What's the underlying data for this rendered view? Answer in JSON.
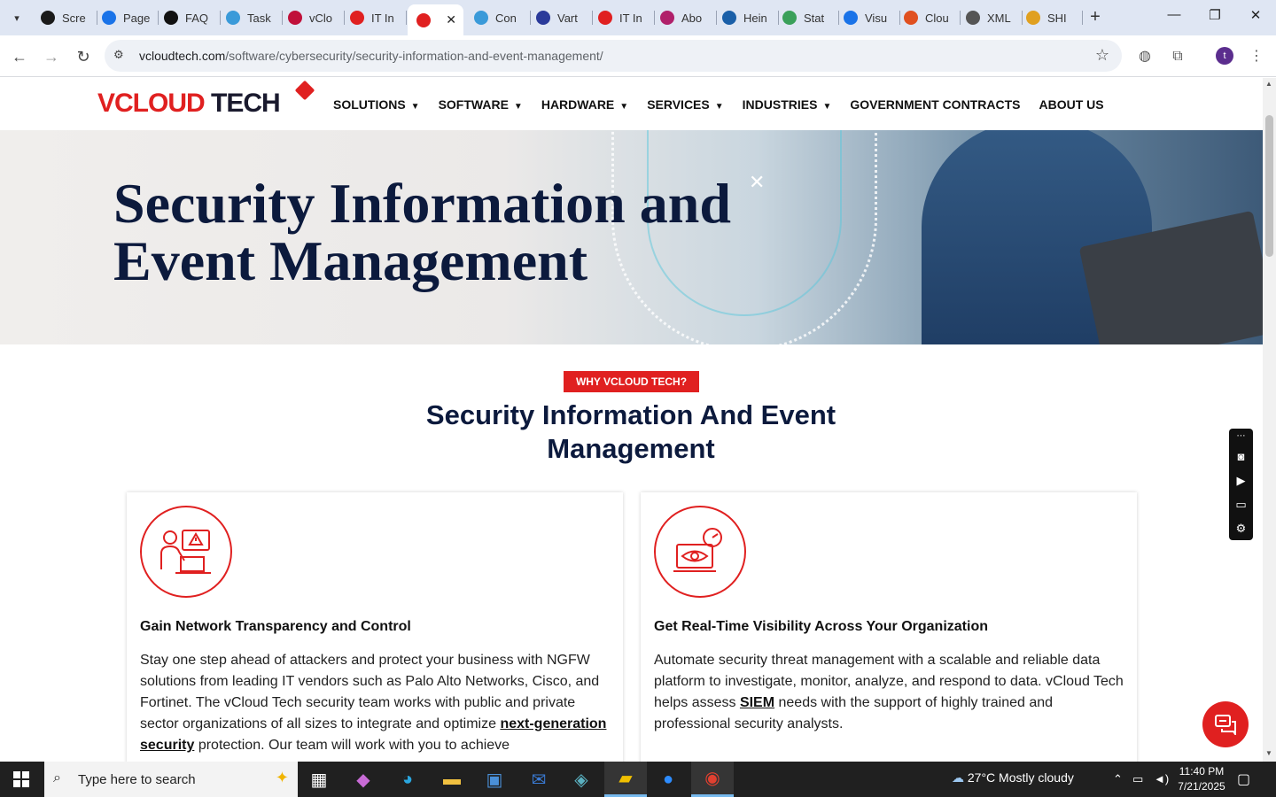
{
  "browser": {
    "tabs": [
      {
        "label": "Scre",
        "fav_color": "#1a1a1a"
      },
      {
        "label": "Page",
        "fav_color": "#1a73e8"
      },
      {
        "label": "FAQ",
        "fav_color": "#111111"
      },
      {
        "label": "Task",
        "fav_color": "#3a9ad9"
      },
      {
        "label": "vClo",
        "fav_color": "#c0103a"
      },
      {
        "label": "IT In",
        "fav_color": "#e02020"
      },
      {
        "label": "",
        "fav_color": "#e02020"
      },
      {
        "label": "Con",
        "fav_color": "#3a9ad9"
      },
      {
        "label": "Vart",
        "fav_color": "#2a3a9a"
      },
      {
        "label": "IT In",
        "fav_color": "#e02020"
      },
      {
        "label": "Abo",
        "fav_color": "#b0206a"
      },
      {
        "label": "Hein",
        "fav_color": "#1a5fa8"
      },
      {
        "label": "Stat",
        "fav_color": "#3aa05a"
      },
      {
        "label": "Visu",
        "fav_color": "#1a73e8"
      },
      {
        "label": "Clou",
        "fav_color": "#e05020"
      },
      {
        "label": "XML",
        "fav_color": "#555555"
      },
      {
        "label": "SHI",
        "fav_color": "#e0a020"
      }
    ],
    "url_domain": "vcloudtech.com",
    "url_path": "/software/cybersecurity/security-information-and-event-management/",
    "profile_initial": "t"
  },
  "site": {
    "logo_v": "V",
    "logo_cloud": "CLOUD",
    "logo_tech": "TECH",
    "nav": [
      {
        "label": "SOLUTIONS",
        "dropdown": true
      },
      {
        "label": "SOFTWARE",
        "dropdown": true
      },
      {
        "label": "HARDWARE",
        "dropdown": true
      },
      {
        "label": "SERVICES",
        "dropdown": true
      },
      {
        "label": "INDUSTRIES",
        "dropdown": true
      },
      {
        "label": "GOVERNMENT CONTRACTS",
        "dropdown": false
      },
      {
        "label": "ABOUT US",
        "dropdown": false
      }
    ],
    "hero_title": "Security Information and Event Management",
    "why_badge": "WHY VCLOUD TECH?",
    "section_title": "Security Information And Event Management",
    "cards": [
      {
        "title": "Gain Network Transparency and Control",
        "body_before": "Stay one step ahead of attackers and protect your business with NGFW solutions from leading IT vendors such as Palo Alto Networks, Cisco, and Fortinet. The vCloud Tech security team works with public and private sector organizations of all sizes to integrate and optimize ",
        "link": "next-generation security",
        "body_after": " protection. Our team will work with you to achieve"
      },
      {
        "title": "Get Real-Time Visibility Across Your Organization",
        "body_before": "Automate security threat management with a scalable and reliable data platform to investigate, monitor, analyze, and respond to data. vCloud Tech helps assess ",
        "link": "SIEM",
        "body_after": " needs with the support of highly trained and professional security analysts."
      }
    ],
    "accent_color": "#e02020",
    "navy_color": "#0c1a3d"
  },
  "taskbar": {
    "search_placeholder": "Type here to search",
    "weather": "27°C  Mostly cloudy",
    "time": "11:40 PM",
    "date": "7/21/2025"
  }
}
